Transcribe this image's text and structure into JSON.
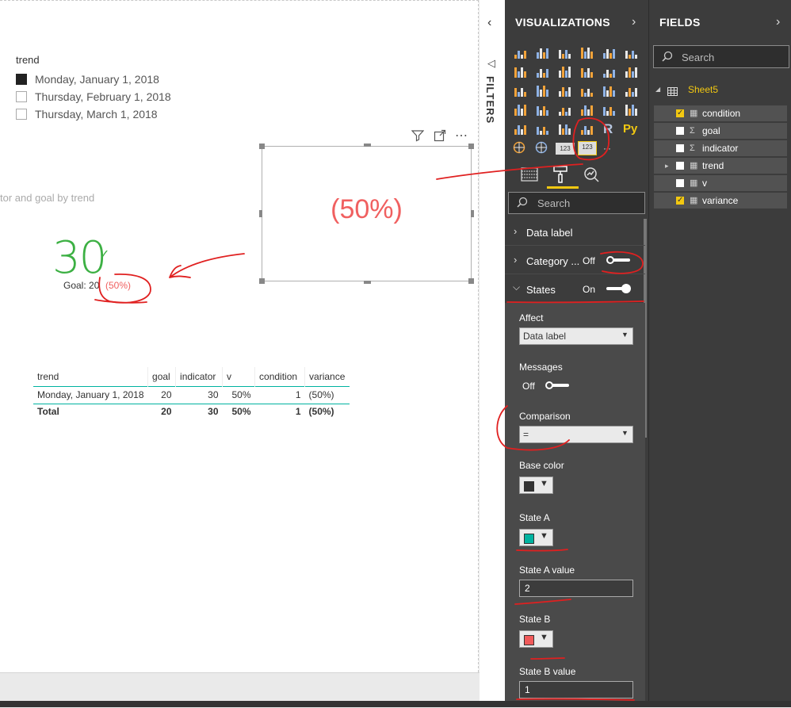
{
  "canvas": {
    "slicer": {
      "title": "trend",
      "items": [
        {
          "label": "Monday, January 1, 2018",
          "checked": true
        },
        {
          "label": "Thursday, February 1, 2018",
          "checked": false
        },
        {
          "label": "Thursday, March 1, 2018",
          "checked": false
        }
      ]
    },
    "card": {
      "value": "(50%)",
      "value_color": "#f06060"
    },
    "kpi": {
      "title": "tor and goal by trend",
      "value": "30",
      "check": "✓",
      "goal_label": "Goal: 20",
      "variance": "(50%)",
      "value_color": "#3cb043",
      "variance_color": "#f06060"
    },
    "table": {
      "columns": [
        "trend",
        "goal",
        "indicator",
        "v",
        "condition",
        "variance"
      ],
      "rows": [
        [
          "Monday, January 1, 2018",
          "20",
          "30",
          "50%",
          "1",
          "(50%)"
        ]
      ],
      "total": [
        "Total",
        "20",
        "30",
        "50%",
        "1",
        "(50%)"
      ]
    },
    "visual_header_icons": [
      "filter-icon",
      "focus-mode-icon",
      "more-options-icon"
    ]
  },
  "filters": {
    "label": "FILTERS"
  },
  "visualizations": {
    "title": "VISUALIZATIONS",
    "tabs": [
      "fields-well-icon",
      "format-paint-roller-icon",
      "analytics-icon"
    ],
    "search_placeholder": "Search",
    "gallery_text_icons": {
      "r": "R",
      "py": "Py",
      "n123": "123",
      "more": "···"
    },
    "sections": {
      "data_label": "Data label",
      "category": {
        "label": "Category ...",
        "state": "Off"
      },
      "states": {
        "label": "States",
        "state": "On"
      }
    },
    "states_panel": {
      "affect_label": "Affect",
      "affect_value": "Data label",
      "messages_label": "Messages",
      "messages_state": "Off",
      "comparison_label": "Comparison",
      "comparison_value": "=",
      "base_color_label": "Base color",
      "base_color": "#333333",
      "state_a_label": "State A",
      "state_a_color": "#00b3a0",
      "state_a_value_label": "State A value",
      "state_a_value": "2",
      "state_b_label": "State B",
      "state_b_color": "#f05a5a",
      "state_b_value_label": "State B value",
      "state_b_value": "1"
    }
  },
  "fields": {
    "title": "FIELDS",
    "search_placeholder": "Search",
    "table_name": "Sheet5",
    "items": [
      {
        "name": "condition",
        "type": "calc",
        "checked": true
      },
      {
        "name": "goal",
        "type": "sum",
        "checked": false
      },
      {
        "name": "indicator",
        "type": "sum",
        "checked": false
      },
      {
        "name": "trend",
        "type": "table",
        "checked": false
      },
      {
        "name": "v",
        "type": "calc",
        "checked": false
      },
      {
        "name": "variance",
        "type": "calc",
        "checked": true
      }
    ]
  },
  "colors": {
    "accent_yellow": "#f2c811",
    "annotation_red": "#e02020"
  }
}
